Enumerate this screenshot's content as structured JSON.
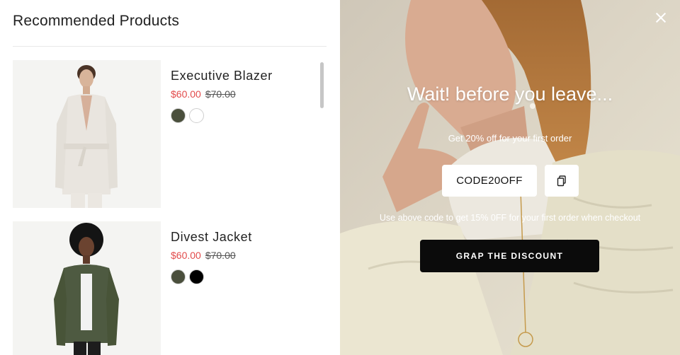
{
  "recommended": {
    "title": "Recommended Products",
    "products": [
      {
        "name": "Executive Blazer",
        "sale_price": "$60.00",
        "old_price": "$70.00",
        "swatches": [
          "#4a4f3c",
          "#ffffff"
        ]
      },
      {
        "name": "Divest Jacket",
        "sale_price": "$60.00",
        "old_price": "$70.00",
        "swatches": [
          "#4a4f3c",
          "#000000"
        ]
      }
    ]
  },
  "popup": {
    "headline": "Wait! before you leave...",
    "subtitle": "Get 20% off for your first order",
    "code": "CODE20OFF",
    "hint": "Use above code to get 15% 0FF for your first order when checkout",
    "cta_label": "GRAP THE DISCOUNT"
  },
  "colors": {
    "sale_price": "#e24b4b",
    "cta_background": "#0b0b0b",
    "panel_background": "#e8e2d2"
  },
  "icons": {
    "close": "close-icon",
    "copy": "copy-icon"
  }
}
